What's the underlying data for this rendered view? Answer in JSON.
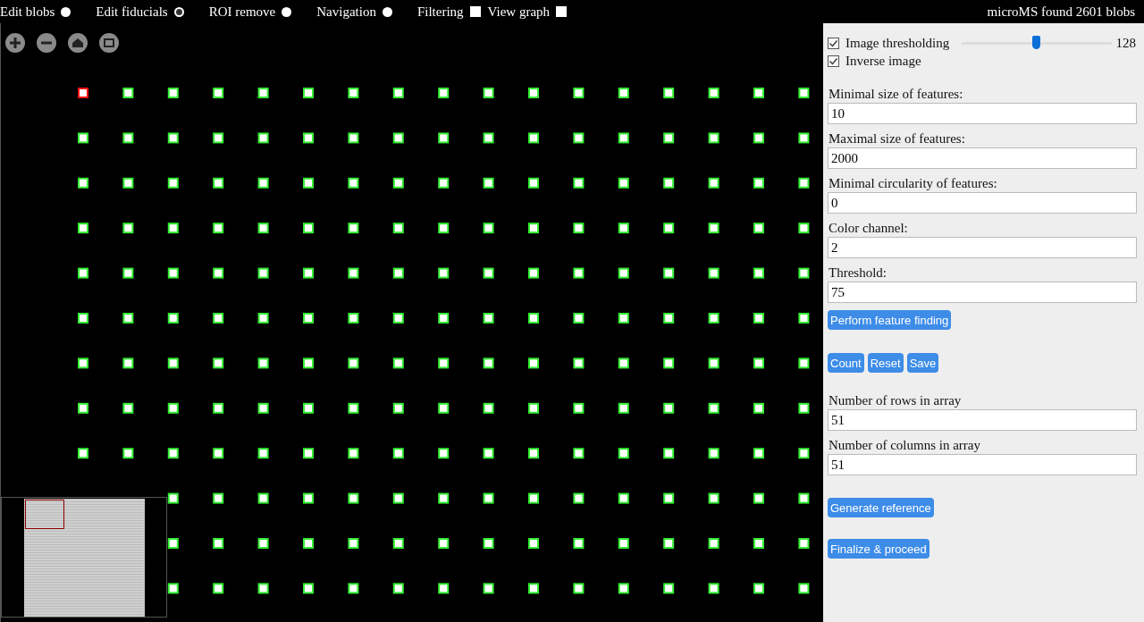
{
  "top_bar": {
    "modes": [
      {
        "label": "Edit blobs",
        "selected": false
      },
      {
        "label": "Edit fiducials",
        "selected": true
      },
      {
        "label": "ROI remove",
        "selected": false
      },
      {
        "label": "Navigation",
        "selected": false
      }
    ],
    "toggles": [
      {
        "label": "Filtering",
        "checked": false
      },
      {
        "label": "View graph",
        "checked": false
      }
    ],
    "status": "microMS found 2601 blobs"
  },
  "panel": {
    "options": [
      {
        "label": "Image thresholding",
        "checked": true,
        "slider": {
          "level": 0.5,
          "reading": "128"
        }
      },
      {
        "label": "Inverse image",
        "checked": true
      }
    ],
    "feature_fields": [
      {
        "label": "Minimal size of features:",
        "value": "10"
      },
      {
        "label": "Maximal size of features:",
        "value": "2000"
      },
      {
        "label": "Minimal circularity of features:",
        "value": "0"
      },
      {
        "label": "Color channel:",
        "value": "2"
      },
      {
        "label": "Threshold:",
        "value": "75"
      }
    ],
    "perform_button": "Perform feature finding",
    "actions": [
      "Count",
      "Reset",
      "Save"
    ],
    "array_fields": [
      {
        "label": "Number of rows in array",
        "value": "51"
      },
      {
        "label": "Number of columns in array",
        "value": "51"
      }
    ],
    "buttons": [
      "Generate reference",
      "Finalize & proceed"
    ]
  }
}
